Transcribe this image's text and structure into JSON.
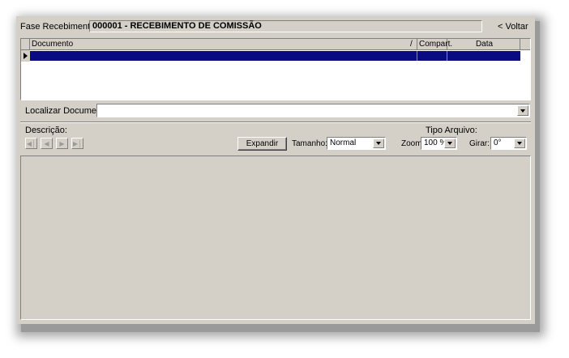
{
  "header": {
    "phase_label": "Fase Recebimento:",
    "phase_value": "000001 - RECEBIMENTO DE COMISSÃO",
    "back_label": "< Voltar"
  },
  "grid": {
    "columns": [
      "Documento",
      "/",
      "Compart.",
      "Data"
    ],
    "selected_row_color": "#0a0a82"
  },
  "search": {
    "label": "Localizar Documento:",
    "value": ""
  },
  "viewer": {
    "description_label": "Descrição:",
    "file_type_label": "Tipo Arquivo:",
    "expand_label": "Expandir",
    "size_label": "Tamanho:",
    "size_value": "Normal",
    "zoom_label": "Zoom:",
    "zoom_value": "100 %",
    "rotate_label": "Girar:",
    "rotate_value": "0°"
  },
  "nav_icons": [
    "first-record-icon",
    "prev-record-icon",
    "next-record-icon",
    "last-record-icon"
  ]
}
